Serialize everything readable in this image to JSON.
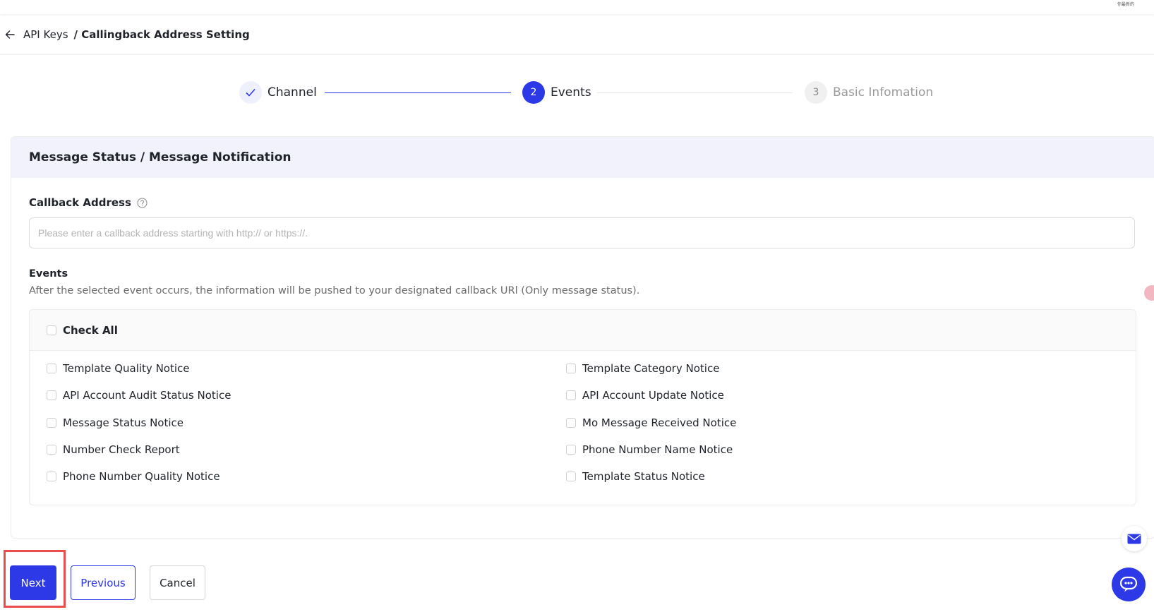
{
  "topbar": {
    "tag": "你最新的"
  },
  "breadcrumb": {
    "parent": "API Keys",
    "current": "/ Callingback Address Setting"
  },
  "steps": [
    {
      "number": "✓",
      "label": "Channel",
      "status": "done"
    },
    {
      "number": "2",
      "label": "Events",
      "status": "active"
    },
    {
      "number": "3",
      "label": "Basic Infomation",
      "status": "pending"
    }
  ],
  "section": {
    "title": "Message Status / Message Notification",
    "callback_label": "Callback Address",
    "callback_value": "",
    "callback_placeholder": "Please enter a callback address starting with http:// or https://.",
    "events_title": "Events",
    "events_desc": "After the selected event occurs, the information will be pushed to your designated callback URl (Only message status)."
  },
  "events": {
    "check_all": "Check All",
    "items": [
      "Template Quality Notice",
      "Template Category Notice",
      "API Account Audit Status Notice",
      "API Account Update Notice",
      "Message Status Notice",
      "Mo Message Received Notice",
      "Number Check Report",
      "Phone Number Name Notice",
      "Phone Number Quality Notice",
      "Template Status Notice"
    ]
  },
  "buttons": {
    "next": "Next",
    "previous": "Previous",
    "cancel": "Cancel"
  },
  "colors": {
    "primary": "#2d38e6",
    "header_bg": "#f2f2fd",
    "highlight": "#ea4d4d"
  },
  "icons": {
    "back": "arrow-left-icon",
    "help": "question-circle-icon",
    "mail": "mail-icon",
    "chat": "chat-icon"
  }
}
